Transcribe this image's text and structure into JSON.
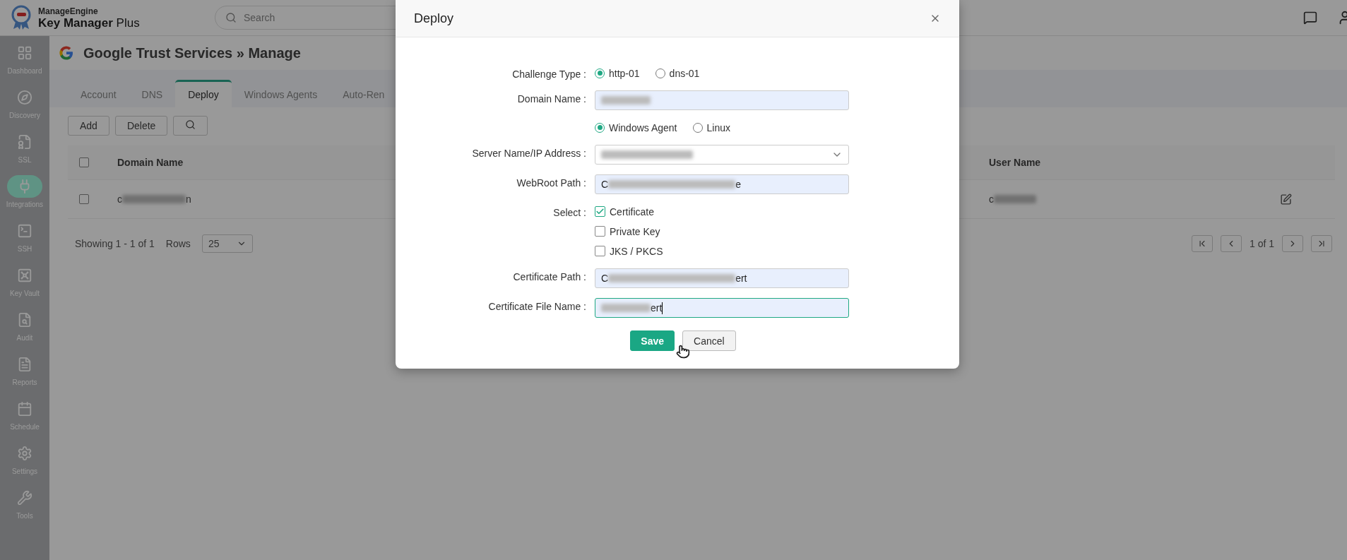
{
  "app": {
    "brand_top": "ManageEngine",
    "brand_main": "Key Manager",
    "brand_suffix": "Plus"
  },
  "search": {
    "placeholder": "Search"
  },
  "sidebar": {
    "items": [
      {
        "label": "Dashboard",
        "selected": false
      },
      {
        "label": "Discovery",
        "selected": false
      },
      {
        "label": "SSL",
        "selected": false
      },
      {
        "label": "Integrations",
        "selected": true
      },
      {
        "label": "SSH",
        "selected": false
      },
      {
        "label": "Key Vault",
        "selected": false
      },
      {
        "label": "Audit",
        "selected": false
      },
      {
        "label": "Reports",
        "selected": false
      },
      {
        "label": "Schedule",
        "selected": false
      },
      {
        "label": "Settings",
        "selected": false
      },
      {
        "label": "Tools",
        "selected": false
      }
    ]
  },
  "page": {
    "title": "Google Trust Services » Manage"
  },
  "tabs": [
    {
      "label": "Account",
      "selected": false
    },
    {
      "label": "DNS",
      "selected": false
    },
    {
      "label": "Deploy",
      "selected": true
    },
    {
      "label": "Windows Agents",
      "selected": false
    },
    {
      "label": "Auto-Ren",
      "selected": false
    }
  ],
  "toolbar": {
    "buttons": [
      "Add",
      "Delete"
    ]
  },
  "table": {
    "header_checked": false,
    "columns": [
      {
        "label": "Domain Name"
      },
      {
        "label": "User Name"
      }
    ],
    "rows": [
      {
        "domain_name": {
          "prefix": "c",
          "suffix": "n",
          "redacted": true
        },
        "user_name": {
          "prefix": "c",
          "redacted": true
        },
        "checked": false
      }
    ]
  },
  "pagination": {
    "showing": "Showing 1 - 1 of 1",
    "rows_label": "Rows",
    "rows_value": "25",
    "page": "1 of 1"
  },
  "dialog": {
    "title": "Deploy",
    "fields": [
      {
        "kind": "radio",
        "label": "Challenge Type :",
        "options": [
          {
            "label": "http-01",
            "selected": true
          },
          {
            "label": "dns-01",
            "selected": false
          }
        ]
      },
      {
        "kind": "text",
        "label": "Domain Name :",
        "redacted": true,
        "focused": false
      },
      {
        "kind": "radio",
        "options": [
          {
            "label": "Windows Agent",
            "selected": true
          },
          {
            "label": "Linux",
            "selected": false
          }
        ]
      },
      {
        "kind": "select",
        "label": "Server Name/IP Address :",
        "redacted": true
      },
      {
        "kind": "text",
        "label": "WebRoot Path :",
        "prefix": "C",
        "suffix": "e",
        "redacted": true,
        "focused": false
      },
      {
        "kind": "checkbox",
        "label": "Select :",
        "options": [
          {
            "label": "Certificate",
            "checked": true
          },
          {
            "label": "Private Key",
            "checked": false
          },
          {
            "label": "JKS / PKCS",
            "checked": false
          }
        ]
      },
      {
        "kind": "text",
        "label": "Certificate Path :",
        "prefix": "C",
        "suffix": "ert",
        "redacted": true,
        "focused": false
      },
      {
        "kind": "text",
        "label": "Certificate File Name :",
        "suffix": "ert",
        "redacted": true,
        "focused": true
      }
    ],
    "buttons": [
      {
        "label": "Save",
        "kind": "primary"
      },
      {
        "label": "Cancel",
        "kind": "secondary"
      }
    ]
  }
}
